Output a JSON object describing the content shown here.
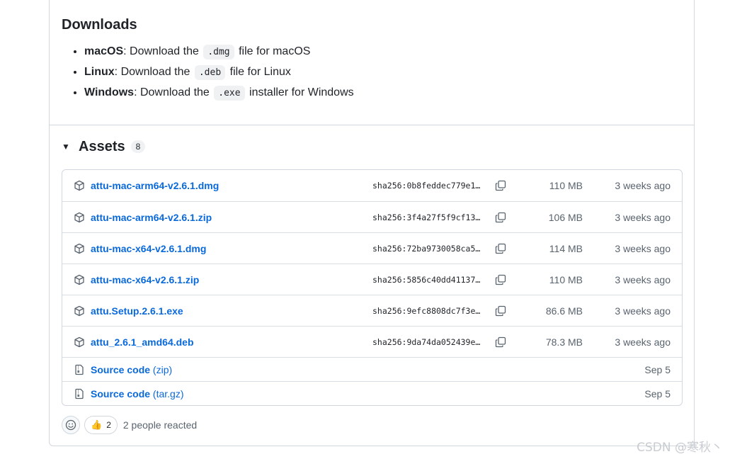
{
  "downloads": {
    "title": "Downloads",
    "items": [
      {
        "os": "macOS",
        "pre": ": Download the ",
        "ext": ".dmg",
        "post": " file for macOS"
      },
      {
        "os": "Linux",
        "pre": ": Download the ",
        "ext": ".deb",
        "post": " file for Linux"
      },
      {
        "os": "Windows",
        "pre": ": Download the ",
        "ext": ".exe",
        "post": " installer for Windows"
      }
    ]
  },
  "assets": {
    "title": "Assets",
    "count": "8",
    "files": [
      {
        "name": "attu-mac-arm64-v2.6.1.dmg",
        "sha": "sha256:0b8feddec779e1…",
        "size": "110 MB",
        "date": "3 weeks ago"
      },
      {
        "name": "attu-mac-arm64-v2.6.1.zip",
        "sha": "sha256:3f4a27f5f9cf13…",
        "size": "106 MB",
        "date": "3 weeks ago"
      },
      {
        "name": "attu-mac-x64-v2.6.1.dmg",
        "sha": "sha256:72ba9730058ca5…",
        "size": "114 MB",
        "date": "3 weeks ago"
      },
      {
        "name": "attu-mac-x64-v2.6.1.zip",
        "sha": "sha256:5856c40dd41137…",
        "size": "110 MB",
        "date": "3 weeks ago"
      },
      {
        "name": "attu.Setup.2.6.1.exe",
        "sha": "sha256:9efc8808dc7f3e…",
        "size": "86.6 MB",
        "date": "3 weeks ago"
      },
      {
        "name": "attu_2.6.1_amd64.deb",
        "sha": "sha256:9da74da052439e…",
        "size": "78.3 MB",
        "date": "3 weeks ago"
      }
    ],
    "source": [
      {
        "name": "Source code",
        "format": "(zip)",
        "date": "Sep 5"
      },
      {
        "name": "Source code",
        "format": "(tar.gz)",
        "date": "Sep 5"
      }
    ]
  },
  "reactions": {
    "thumbs_emoji": "👍",
    "thumbs_count": "2",
    "summary": "2 people reacted"
  },
  "watermark": "CSDN @寒秋丶",
  "colors": {
    "link": "#0969da",
    "border": "#d0d7de",
    "muted": "#59636e"
  }
}
